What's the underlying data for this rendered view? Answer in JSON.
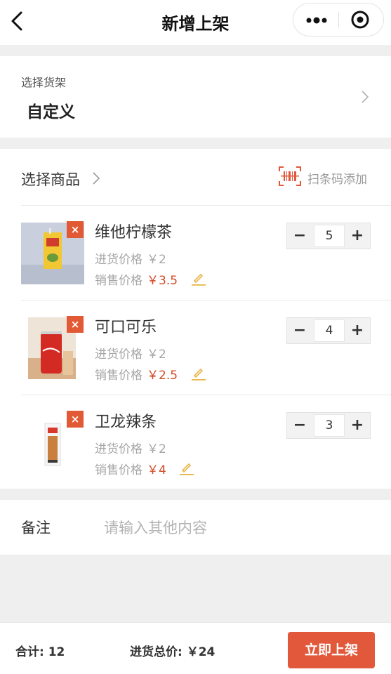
{
  "nav": {
    "title": "新增上架"
  },
  "shelf": {
    "label": "选择货架",
    "value": "自定义"
  },
  "goods": {
    "header_label": "选择商品",
    "scan_label": "扫条码添加",
    "cost_label": "进货价格",
    "sale_label": "销售价格",
    "items": [
      {
        "name": "维他柠檬茶",
        "cost": "￥2",
        "sale": "￥3.5",
        "qty": "5"
      },
      {
        "name": "可口可乐",
        "cost": "￥2",
        "sale": "￥2.5",
        "qty": "4"
      },
      {
        "name": "卫龙辣条",
        "cost": "￥2",
        "sale": "￥4",
        "qty": "3"
      }
    ]
  },
  "remark": {
    "label": "备注",
    "placeholder": "请输入其他内容"
  },
  "footer": {
    "total": "合计: 12",
    "cost_total": "进货总价: ￥24",
    "submit": "立即上架"
  },
  "colors": {
    "accent": "#e2583b",
    "price": "#d24a26",
    "edit": "#e8b54a"
  },
  "icons": [
    "back-arrow-icon",
    "more-dots-icon",
    "target-icon",
    "chevron-right-icon",
    "barcode-icon",
    "pencil-icon"
  ]
}
